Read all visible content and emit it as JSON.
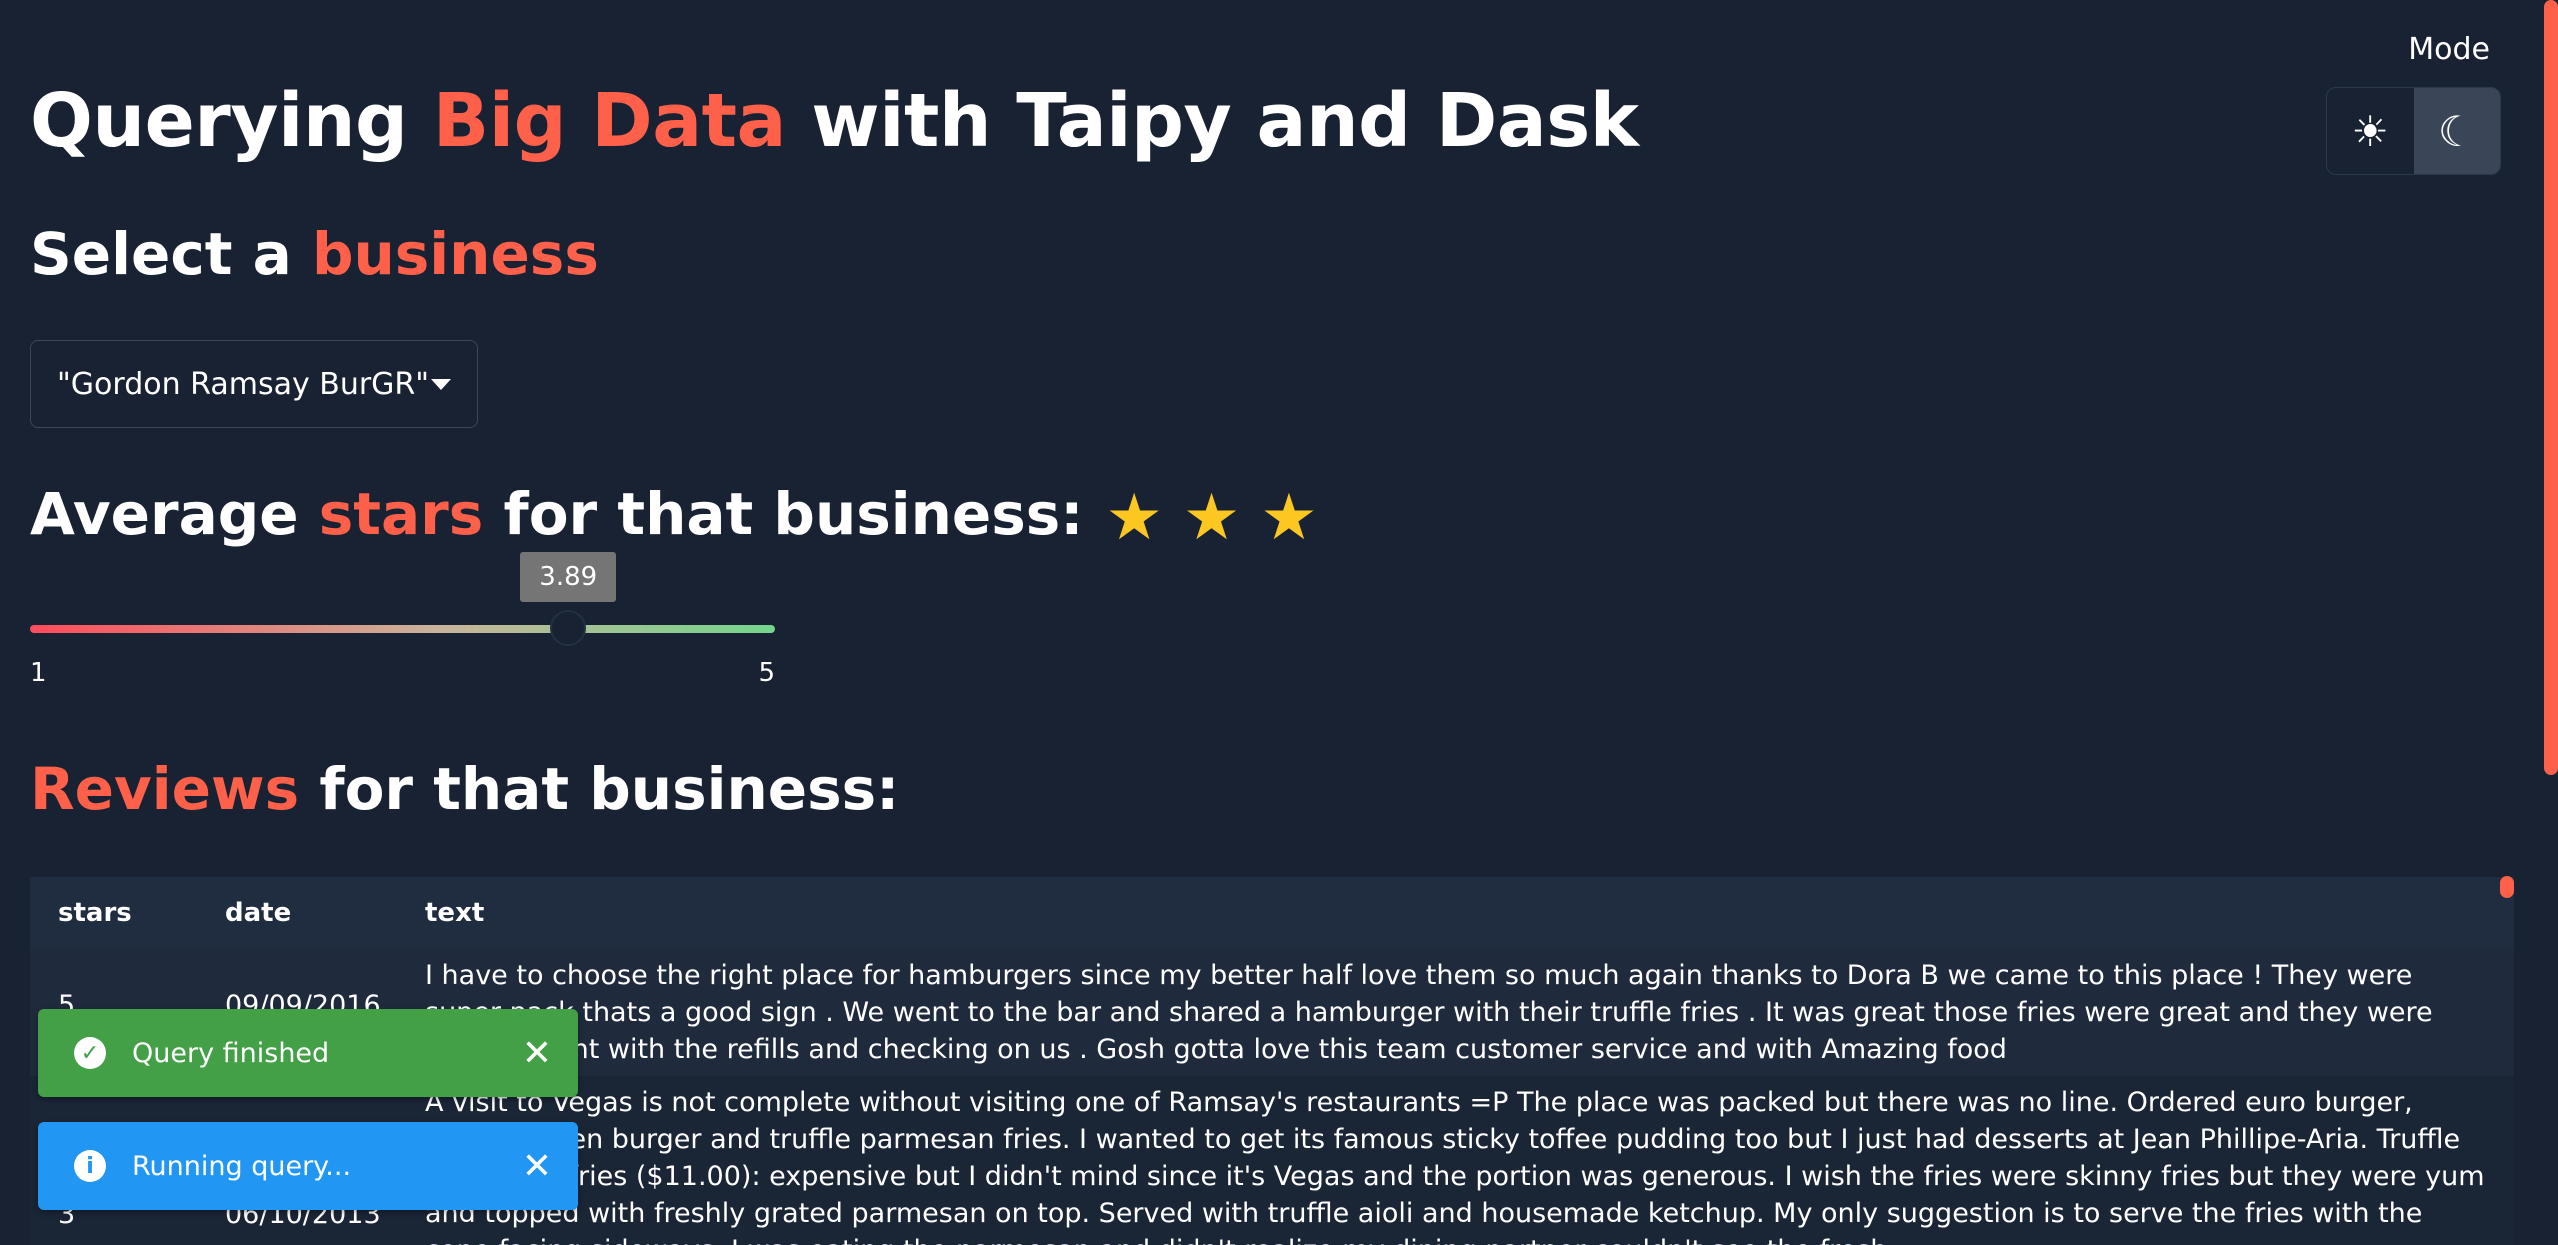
{
  "header": {
    "title_pre": "Querying ",
    "title_accent": "Big Data",
    "title_post": " with Taipy and Dask"
  },
  "mode": {
    "label": "Mode",
    "light_icon": "sun-icon",
    "dark_icon": "moon-icon",
    "selected": "dark"
  },
  "select_section": {
    "heading_pre": "Select a ",
    "heading_accent": "business",
    "selected_value": "\"Gordon Ramsay BurGR\""
  },
  "stars_section": {
    "heading_pre": "Average ",
    "heading_accent": "stars",
    "heading_post": " for that business:",
    "star_count": 3,
    "slider": {
      "value": "3.89",
      "min": "1",
      "max": "5"
    }
  },
  "reviews_section": {
    "heading_accent": "Reviews",
    "heading_post": " for that business:"
  },
  "table": {
    "columns": [
      "stars",
      "date",
      "text"
    ],
    "rows": [
      {
        "stars": "5",
        "date": "09/09/2016",
        "text": "I have to choose the right place for hamburgers since my better half love them so much again thanks to Dora B we came to this place ! They were super pack thats a good sign . We went to the bar and shared a hamburger with their truffle fries . It was great those fries were great and they were also on point with the refills and checking on us . Gosh gotta love this team customer service and with Amazing food"
      },
      {
        "stars": "3",
        "date": "06/10/2013",
        "text": "A visit to Vegas is not complete without visiting one of Ramsay's restaurants =P The place was packed but there was no line. Ordered euro burger, hell's kitchen burger and truffle parmesan fries. I wanted to get its famous sticky toffee pudding too but I just had desserts at Jean Phillipe-Aria. Truffle parmesan fries ($11.00): expensive but I didn't mind since it's Vegas and the portion was generous. I wish the fries were skinny fries but they were yum and topped with freshly grated parmesan on top. Served with truffle aioli and housemade ketchup. My only suggestion is to serve the fries with the cone facing sideways. I was eating the parmesan and didn't realize my dining partner couldn't see the fresh"
      }
    ]
  },
  "notifications": [
    {
      "type": "success",
      "icon": "check-circle-icon",
      "message": "Query finished"
    },
    {
      "type": "info",
      "icon": "info-icon",
      "message": "Running query..."
    }
  ],
  "colors": {
    "background": "#182233",
    "accent": "#ff6049",
    "star": "#fcc721",
    "success": "#43a047",
    "info": "#2196f3"
  }
}
